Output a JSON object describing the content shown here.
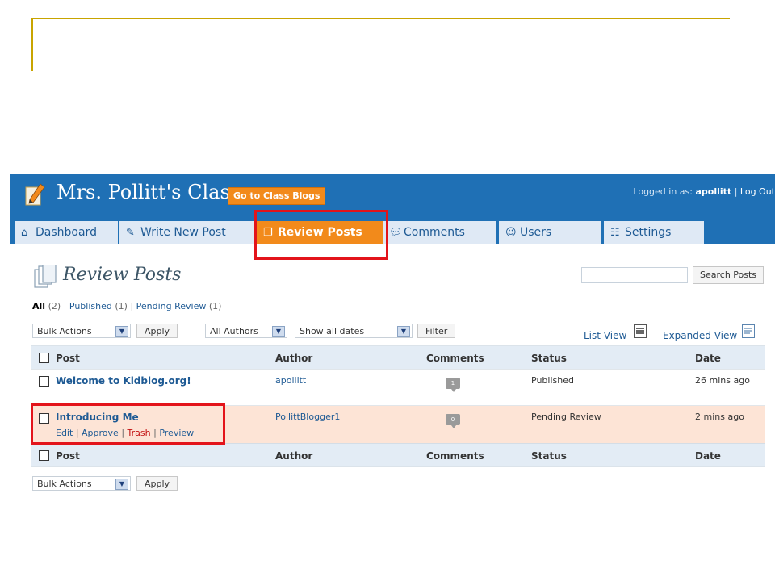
{
  "header": {
    "site_title": "Mrs. Pollitt's Class",
    "class_blogs_button": "Go to Class Blogs",
    "logged_in_prefix": "Logged in as:",
    "username": "apollitt",
    "separator": "|",
    "logout": "Log Out"
  },
  "tabs": [
    {
      "label": "Dashboard",
      "icon": "home-icon"
    },
    {
      "label": "Write New Post",
      "icon": "pencil-icon"
    },
    {
      "label": "Review Posts",
      "icon": "pages-icon",
      "active": true
    },
    {
      "label": "Comments",
      "icon": "speech-bubble-icon"
    },
    {
      "label": "Users",
      "icon": "users-icon"
    },
    {
      "label": "Settings",
      "icon": "settings-icon"
    }
  ],
  "page": {
    "title": "Review Posts",
    "search_button": "Search Posts",
    "search_value": ""
  },
  "status_filters": {
    "all_label": "All",
    "all_count": "(2)",
    "published_label": "Published",
    "published_count": "(1)",
    "pending_label": "Pending Review",
    "pending_count": "(1)",
    "sep": "|"
  },
  "toolbar": {
    "bulk_actions": "Bulk Actions",
    "apply": "Apply",
    "authors": "All Authors",
    "dates": "Show all dates",
    "filter": "Filter",
    "list_view": "List View",
    "expanded_view": "Expanded View"
  },
  "table": {
    "columns": [
      "Post",
      "Author",
      "Comments",
      "Status",
      "Date"
    ],
    "rows": [
      {
        "title": "Welcome to Kidblog.org!",
        "author": "apollitt",
        "comments": "1",
        "status": "Published",
        "date": "26 mins ago"
      },
      {
        "title": "Introducing Me",
        "author": "PollittBlogger1",
        "comments": "0",
        "status": "Pending Review",
        "date": "2 mins ago",
        "actions": {
          "edit": "Edit",
          "approve": "Approve",
          "trash": "Trash",
          "preview": "Preview",
          "sep": "|"
        }
      }
    ]
  },
  "bottom_toolbar": {
    "bulk_actions": "Bulk Actions",
    "apply": "Apply"
  },
  "colors": {
    "header_blue": "#1f70b5",
    "accent_orange": "#f28a1b",
    "highlight_red": "#e3141b",
    "pending_row": "#fde4d6",
    "decor_gold": "#c8a400"
  }
}
